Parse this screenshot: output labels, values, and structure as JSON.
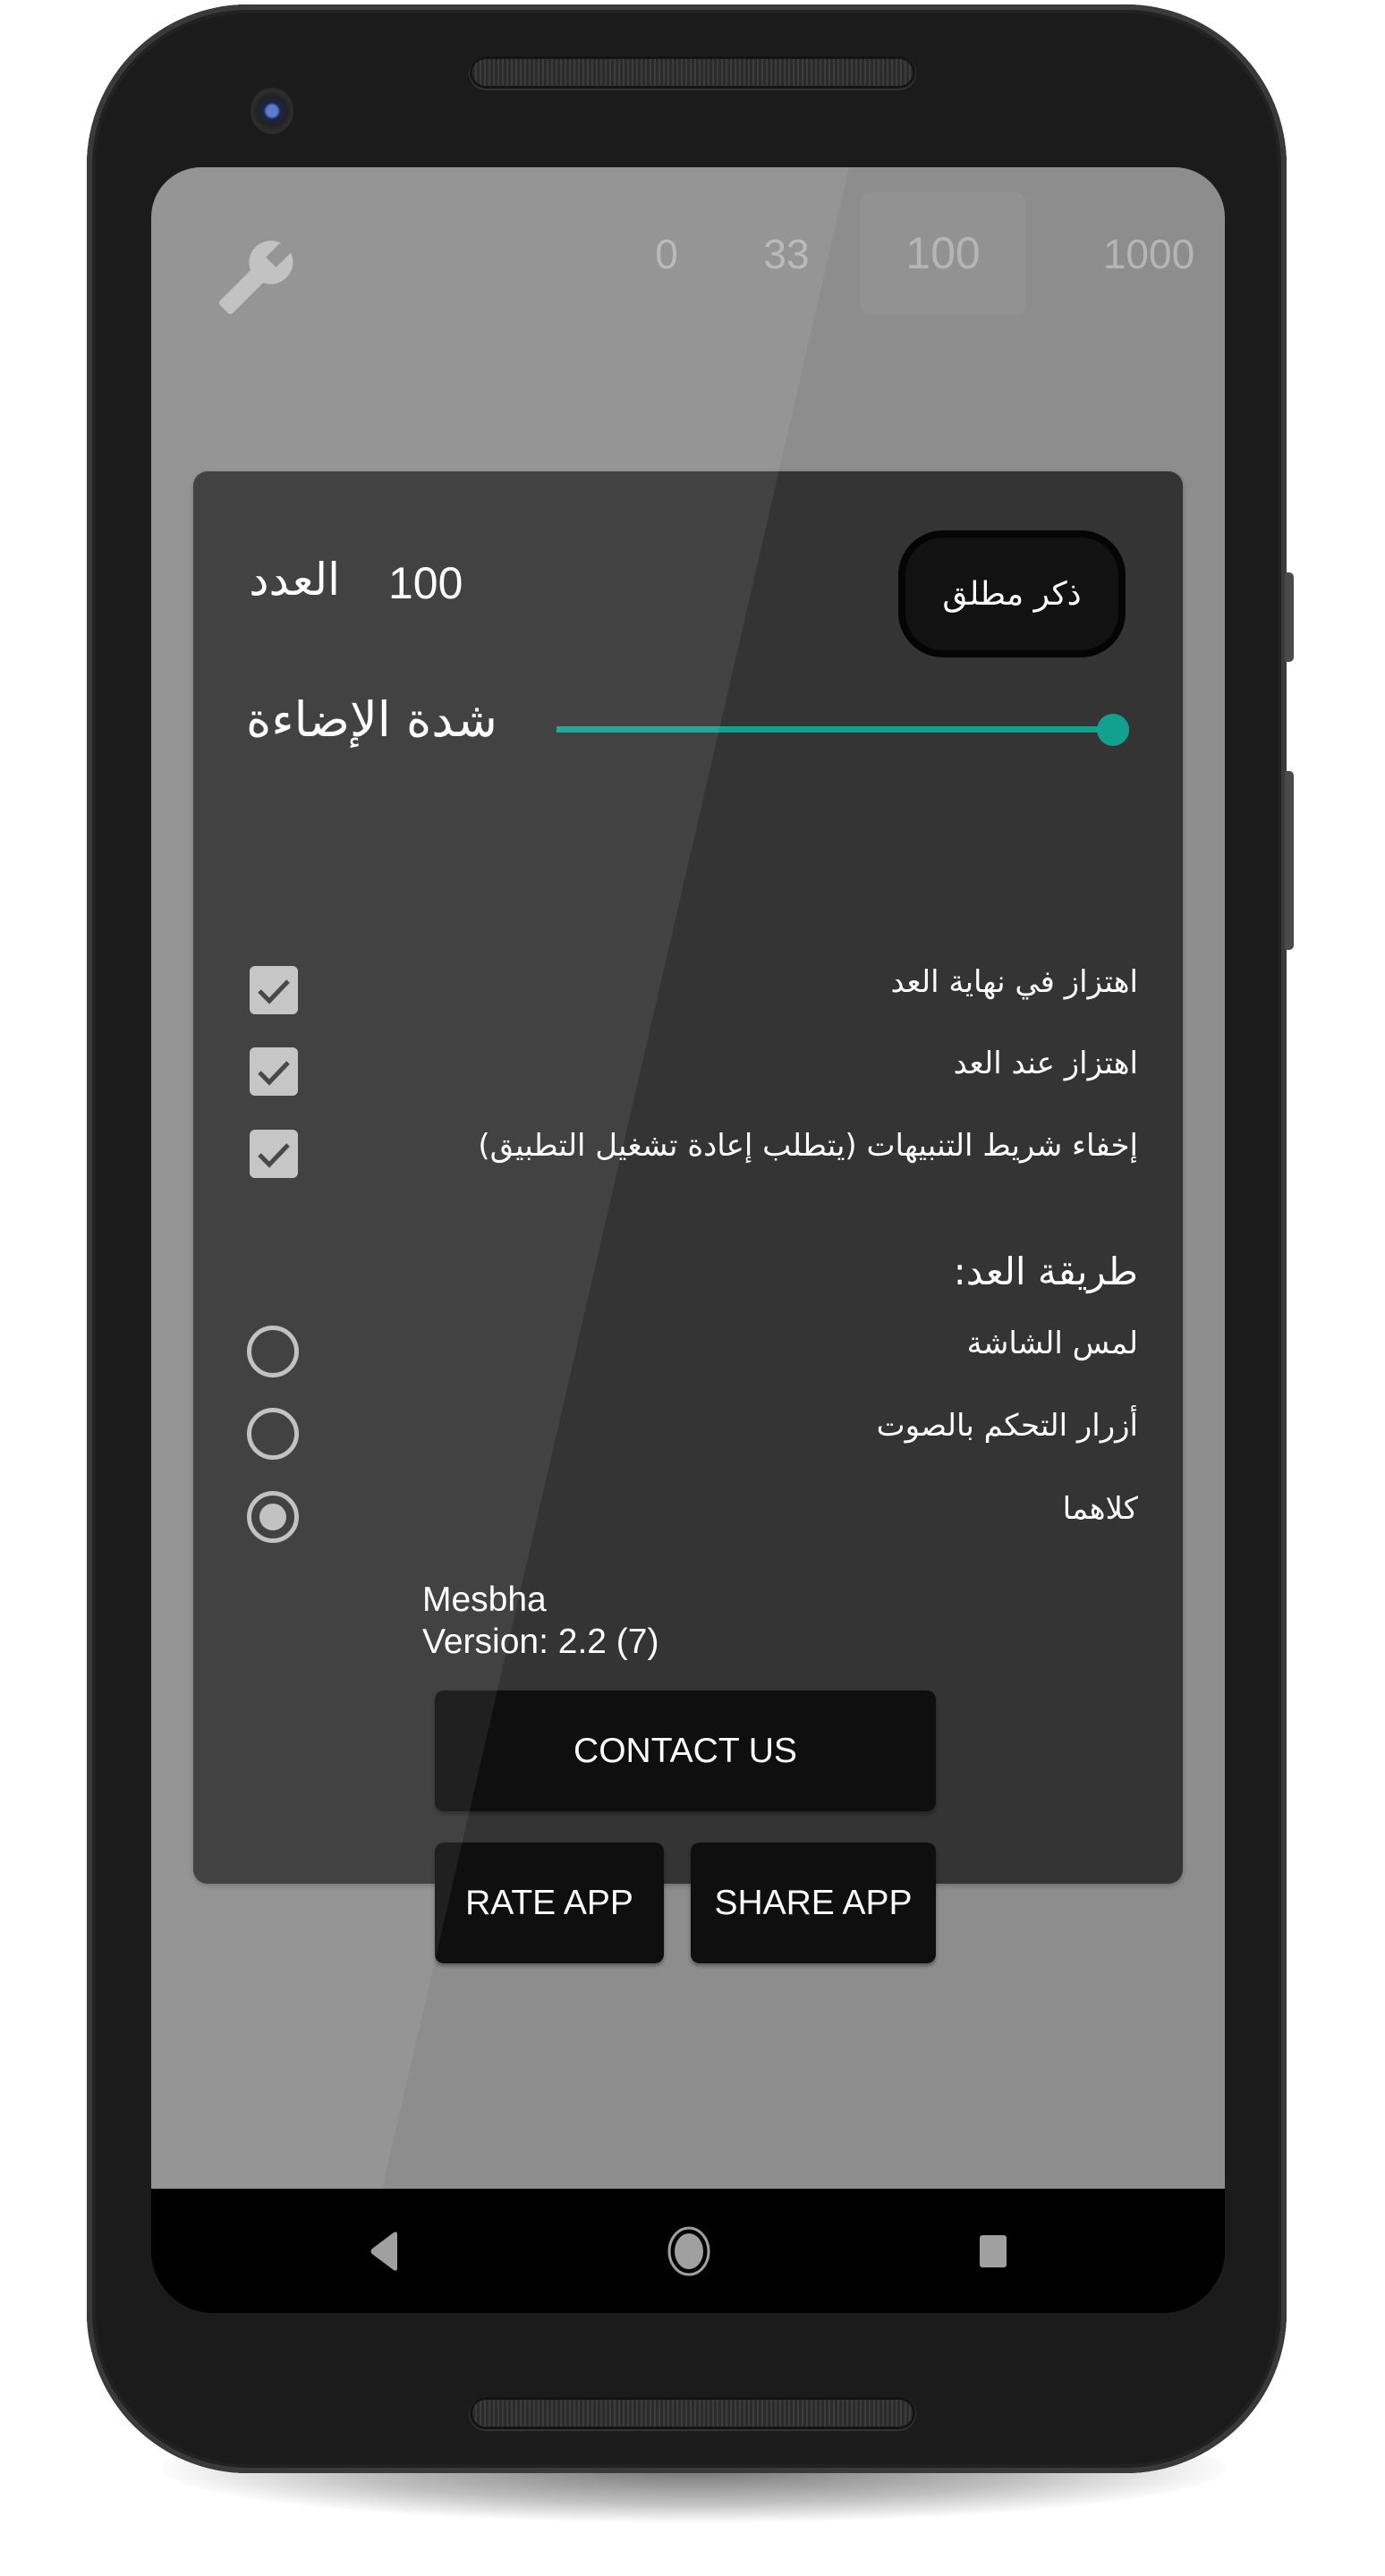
{
  "top_bar": {
    "settings_icon": "wrench-icon",
    "count_options": [
      "0",
      "33",
      "100",
      "1000"
    ],
    "selected_count": "100"
  },
  "dialog": {
    "count_label": "العدد",
    "count_value": "100",
    "zikr_button_label": "ذكر مطلق",
    "brightness_label": "شدة الإضاءة",
    "brightness_level_percent": 100,
    "checkboxes": [
      {
        "label": "اهتزاز في نهاية العد",
        "checked": true
      },
      {
        "label": "اهتزاز عند العد",
        "checked": true
      },
      {
        "label": "إخفاء شريط التنبيهات (يتطلب إعادة تشغيل التطبيق)",
        "checked": true
      }
    ],
    "counting_method_title": "طريقة العد:",
    "counting_methods": [
      {
        "label": "لمس الشاشة",
        "selected": false
      },
      {
        "label": "أزرار التحكم بالصوت",
        "selected": false
      },
      {
        "label": "كلاهما",
        "selected": true
      }
    ],
    "about": {
      "app_name": "Mesbha",
      "version": "Version: 2.2 (7)"
    },
    "buttons": {
      "contact": "CONTACT US",
      "rate": "RATE APP",
      "share": "SHARE APP"
    }
  },
  "navbar": {
    "back_icon": "back-triangle-icon",
    "home_icon": "home-circle-icon",
    "recents_icon": "recents-square-icon"
  },
  "colors": {
    "accent": "#14a08f",
    "dialog_bg": "#343434",
    "scrim": "#8d8d8d"
  }
}
